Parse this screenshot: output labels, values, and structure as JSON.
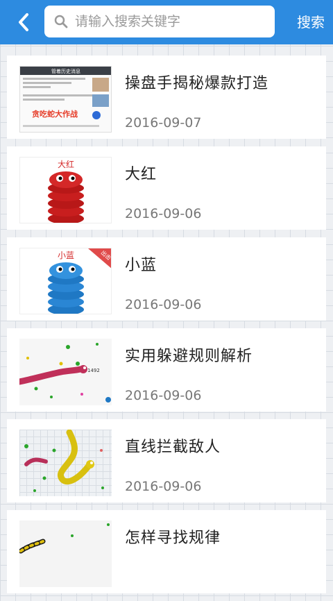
{
  "header": {
    "back_icon": "chevron-left-icon",
    "search_icon": "search-icon",
    "search_placeholder": "请输入搜索关键字",
    "search_button": "搜索",
    "bar_color": "#2d8be0"
  },
  "articles": [
    {
      "title": "操盘手揭秘爆款打造",
      "date": "2016-09-07",
      "thumb_text": "管着历史消息",
      "thumb_banner": "贪吃蛇大作战"
    },
    {
      "title": "大红",
      "date": "2016-09-06",
      "thumb_text": "大红"
    },
    {
      "title": "小蓝",
      "date": "2016-09-06",
      "thumb_text": "小蓝",
      "thumb_ribbon": "出击"
    },
    {
      "title": "实用躲避规则解析",
      "date": "2016-09-06",
      "thumb_text": "1492"
    },
    {
      "title": "直线拦截敌人",
      "date": "2016-09-06"
    },
    {
      "title": "怎样寻找规律",
      "date": ""
    }
  ]
}
